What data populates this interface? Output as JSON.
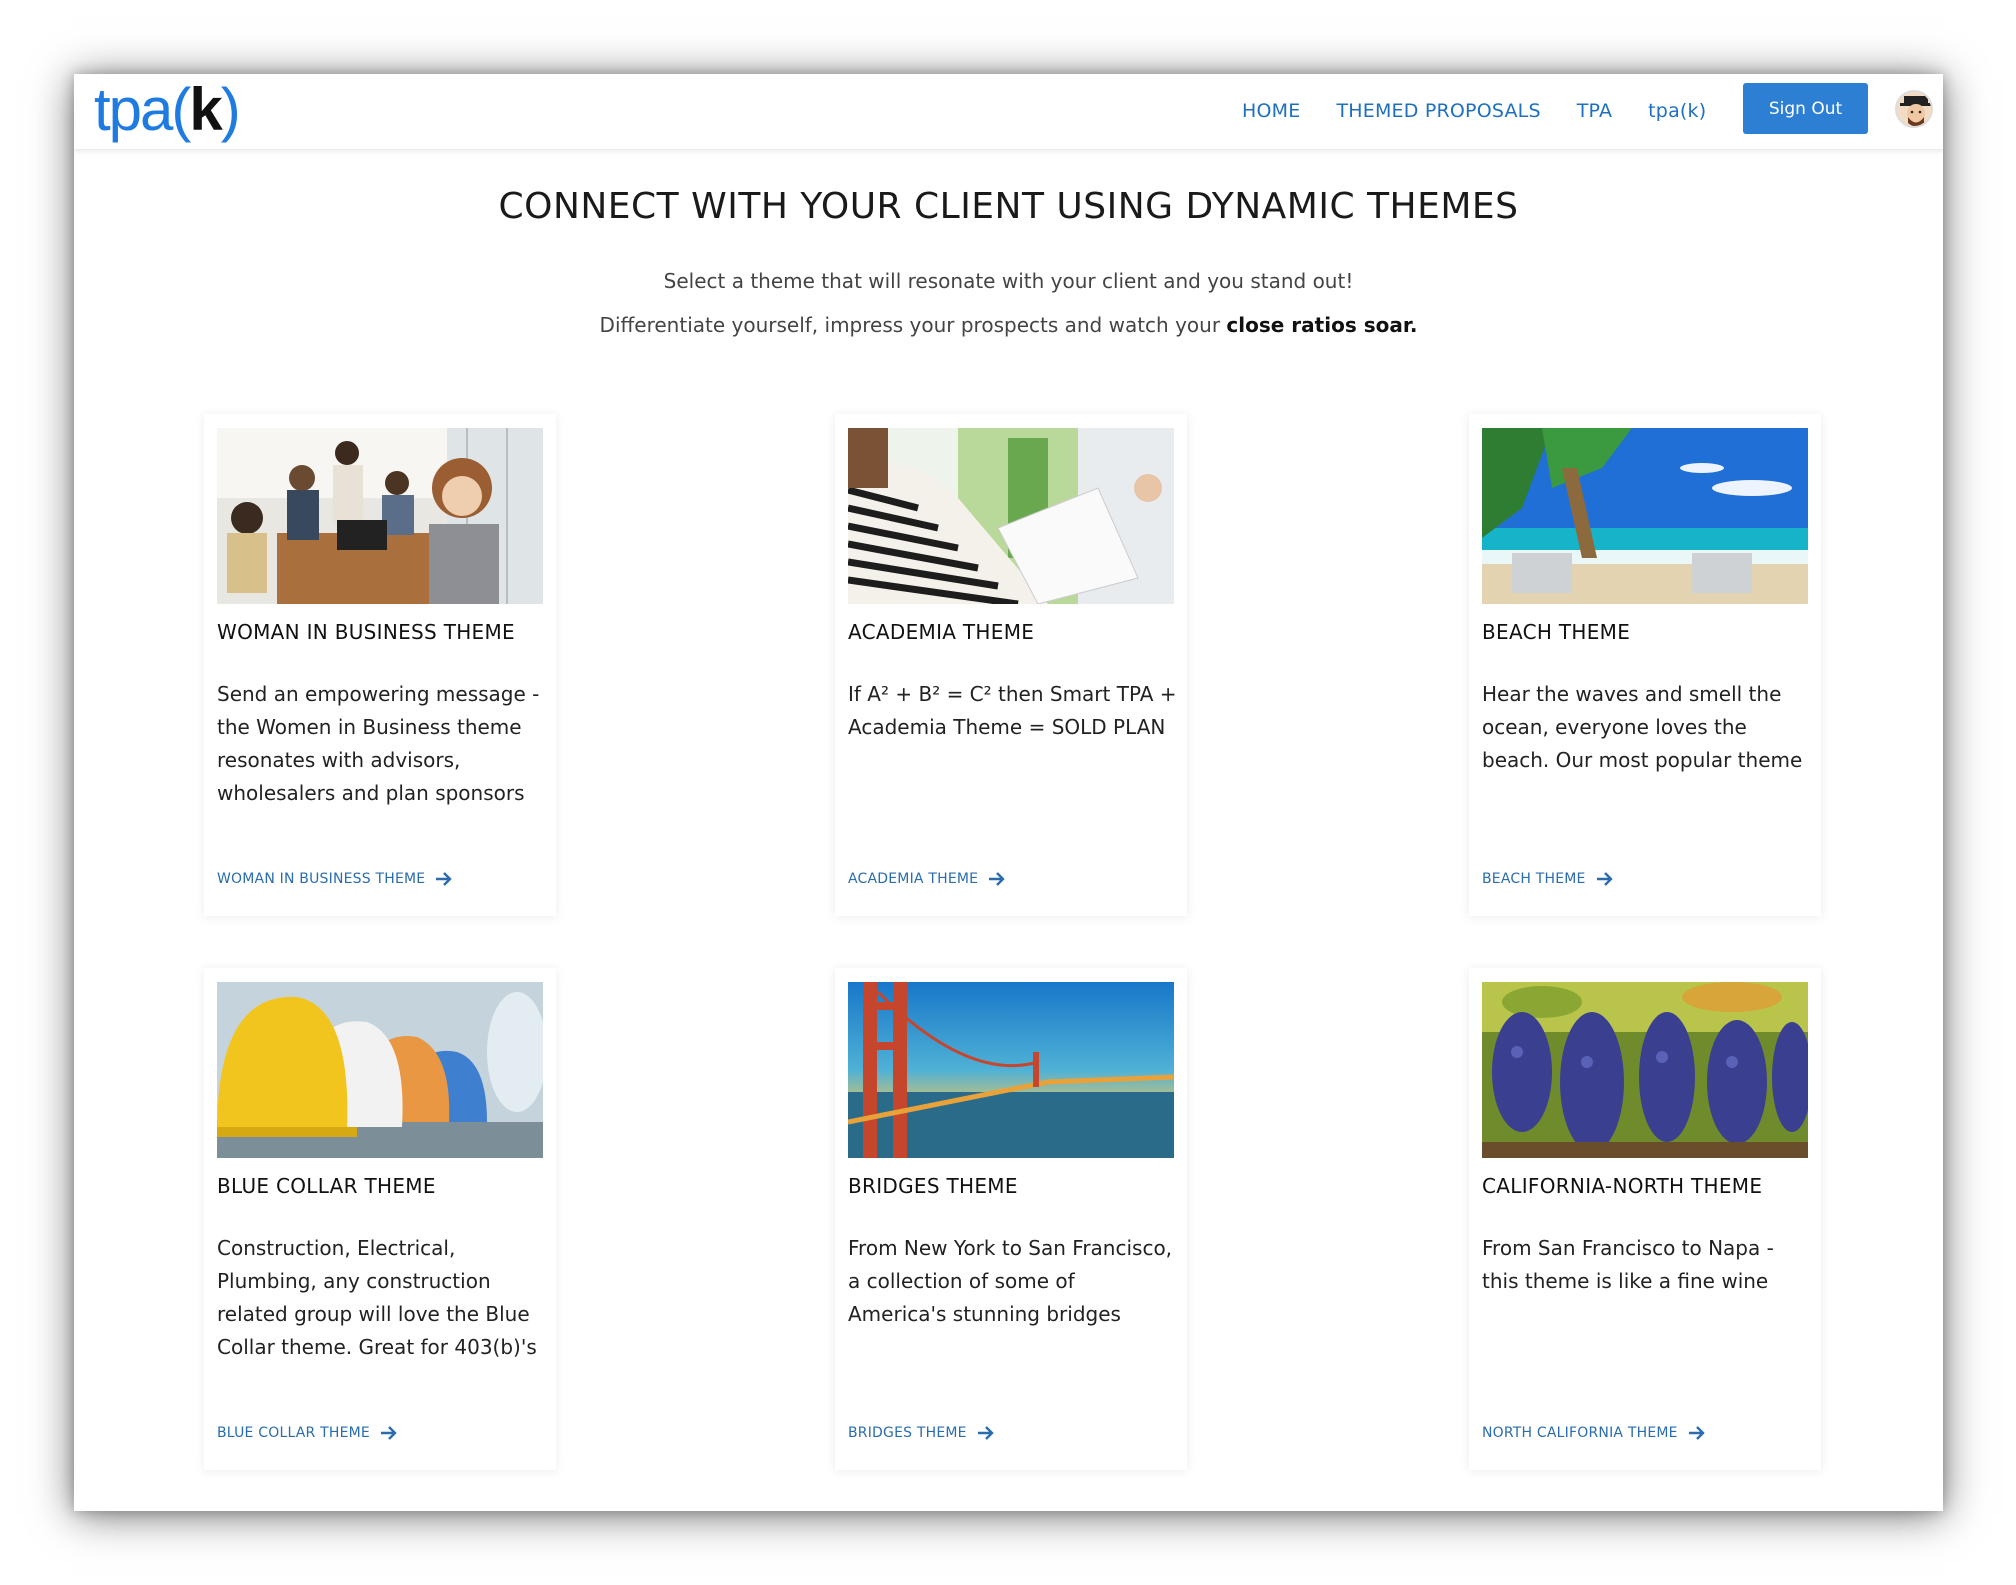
{
  "nav": {
    "logo_prefix": "tpa(",
    "logo_k": "k",
    "logo_suffix": ")",
    "links": [
      "HOME",
      "THEMED PROPOSALS",
      "TPA",
      "tpa(k)"
    ],
    "signout_label": "Sign Out"
  },
  "hero": {
    "headline": "CONNECT WITH YOUR CLIENT USING DYNAMIC THEMES",
    "line1": "Select a theme that will resonate with your client and you stand out!",
    "line2_prefix": "Differentiate yourself, impress your prospects and watch your ",
    "line2_bold": "close ratios soar."
  },
  "cards": [
    {
      "title": "WOMAN IN BUSINESS THEME",
      "body": "Send an empowering message - the Women in Business theme resonates with advisors, wholesalers and plan sponsors",
      "link": "WOMAN IN BUSINESS THEME",
      "image_icon": "business-meeting-image"
    },
    {
      "title": "ACADEMIA THEME",
      "body": "If A² + B² = C² then Smart TPA + Academia Theme = SOLD PLAN",
      "link": "ACADEMIA THEME",
      "image_icon": "student-reading-image"
    },
    {
      "title": "BEACH THEME",
      "body": "Hear the waves and smell the ocean, everyone loves the beach. Our most popular theme",
      "link": "BEACH THEME",
      "image_icon": "beach-palms-image"
    },
    {
      "title": "BLUE COLLAR THEME",
      "body": "Construction, Electrical, Plumbing, any construction related group will love the Blue Collar theme. Great for 403(b)'s",
      "link": "BLUE COLLAR THEME",
      "image_icon": "hard-hats-image"
    },
    {
      "title": "BRIDGES THEME",
      "body": "From New York to San Francisco, a collection of some of America's stunning bridges",
      "link": "BRIDGES THEME",
      "image_icon": "golden-gate-bridge-image"
    },
    {
      "title": "CALIFORNIA-NORTH THEME",
      "body": "From San Francisco to Napa - this theme is like a fine wine",
      "link": "NORTH CALIFORNIA THEME",
      "image_icon": "grape-vineyard-image"
    }
  ],
  "colors": {
    "accent": "#1f7be0",
    "nav_link": "#1f6fc0",
    "button": "#2d7fd3",
    "card_link": "#2a6cad"
  }
}
